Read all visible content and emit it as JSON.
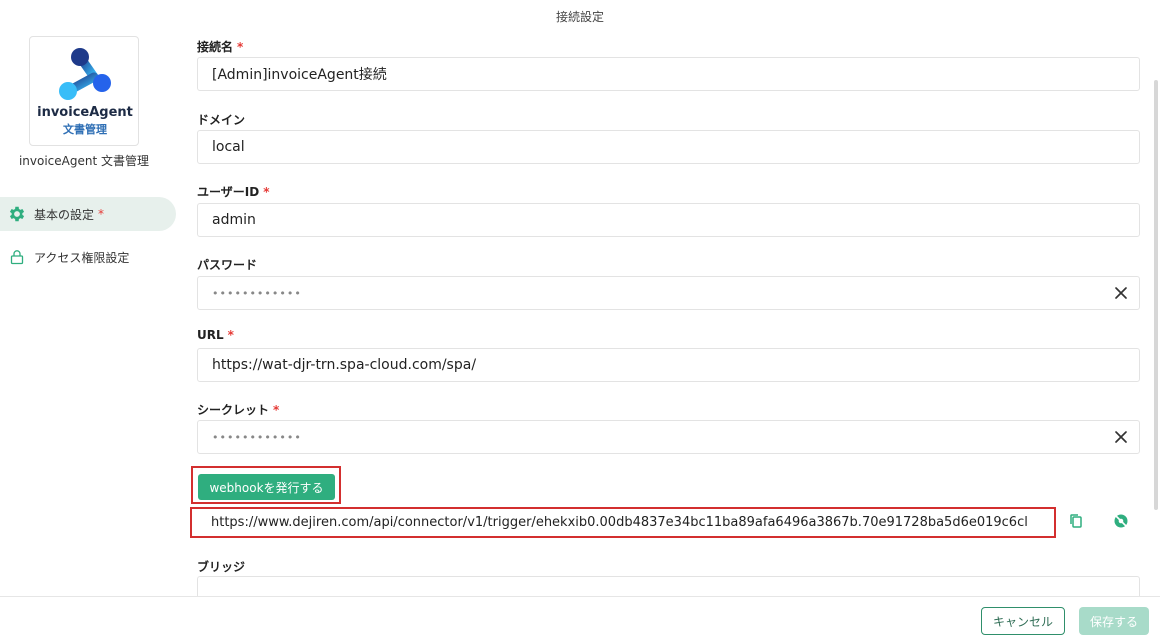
{
  "header": {
    "title": "接続設定"
  },
  "app": {
    "logo_name": "invoiceAgent",
    "logo_sub": "文書管理",
    "name": "invoiceAgent 文書管理"
  },
  "sidebar": {
    "items": [
      {
        "label": "基本の設定",
        "required": "*",
        "icon": "gear-icon",
        "active": true
      },
      {
        "label": "アクセス権限設定",
        "icon": "lock-icon",
        "active": false
      }
    ]
  },
  "form": {
    "required_mark": "*",
    "connection_name": {
      "label": "接続名",
      "value": "[Admin]invoiceAgent接続"
    },
    "domain": {
      "label": "ドメイン",
      "value": "local"
    },
    "user_id": {
      "label": "ユーザーID",
      "value": "admin"
    },
    "password": {
      "label": "パスワード",
      "value": "••••••••••••"
    },
    "url": {
      "label": "URL",
      "value": "https://wat-djr-trn.spa-cloud.com/spa/"
    },
    "secret": {
      "label": "シークレット",
      "value": "••••••••••••"
    },
    "webhook": {
      "button_label": "webhookを発行する",
      "value": "https://www.dejiren.com/api/connector/v1/trigger/ehekxib0.00db4837e34bc11ba89afa6496a3867b.70e91728ba5d6e019c6cl"
    },
    "bridge": {
      "label": "ブリッジ"
    }
  },
  "footer": {
    "cancel_label": "キャンセル",
    "save_label": "保存する"
  },
  "colors": {
    "accent": "#2fae7f",
    "highlight": "#d32f2f",
    "required": "#e53935"
  }
}
